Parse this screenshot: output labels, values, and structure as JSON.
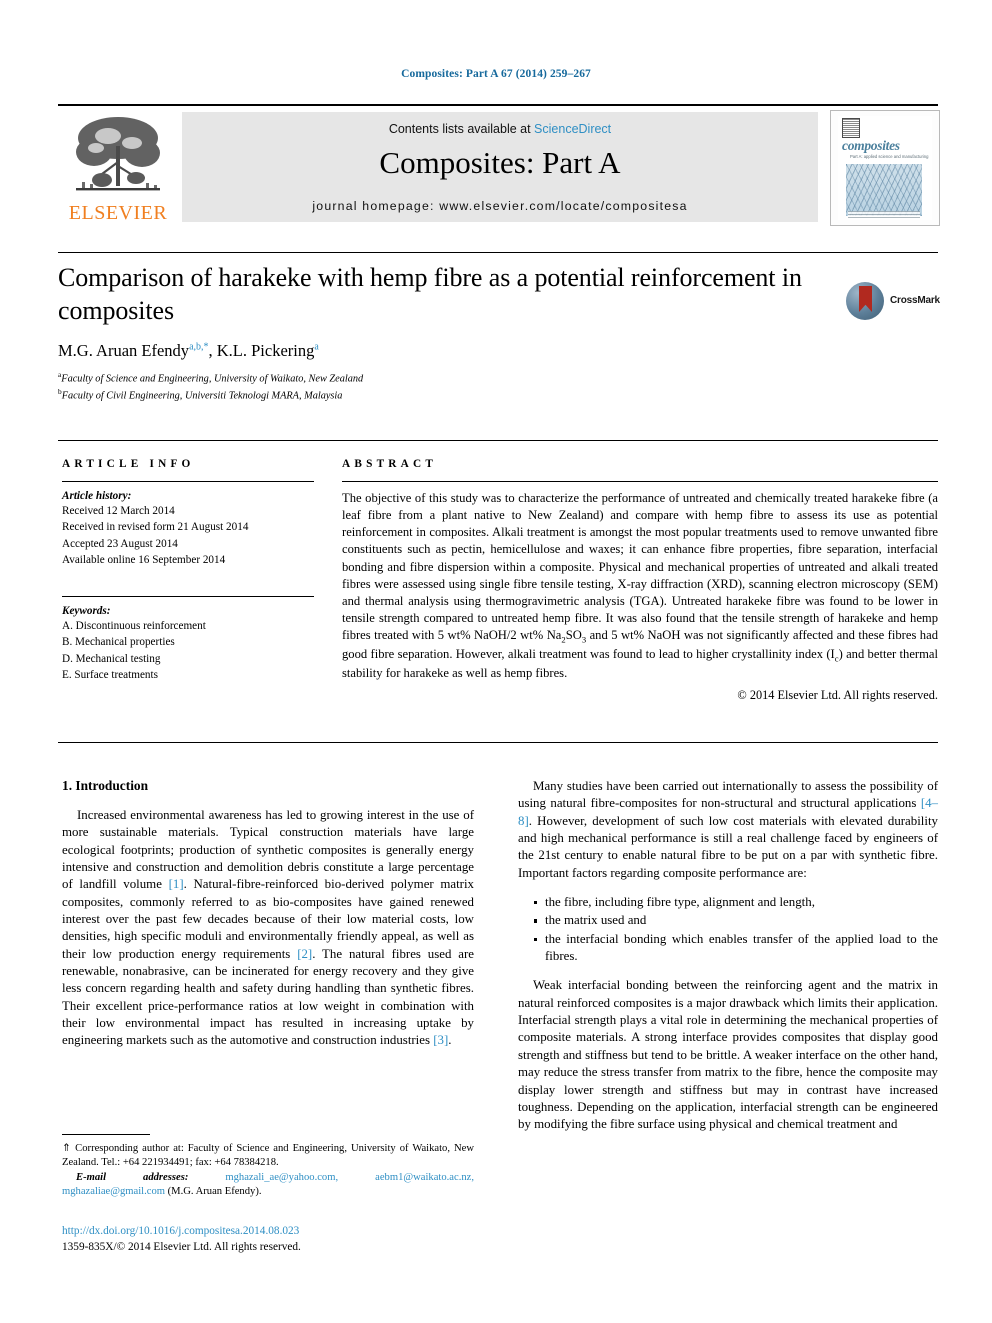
{
  "running_head": "Composites: Part A 67 (2014) 259–267",
  "masthead": {
    "publisher": "ELSEVIER",
    "contents_prefix": "Contents lists available at ",
    "sciencedirect": "ScienceDirect",
    "journal_name": "Composites: Part A",
    "homepage": "journal homepage: www.elsevier.com/locate/compositesa",
    "cover": {
      "title": "composites",
      "subtitle": "Part A: applied science and manufacturing"
    }
  },
  "article": {
    "title": "Comparison of harakeke with hemp fibre as a potential reinforcement in composites",
    "crossmark_label": "CrossMark",
    "authors_html": "M.G. Aruan Efendy<sup>a,b,</sup><sup>*</sup>, K.L. Pickering<sup>a</sup>",
    "affiliations": [
      {
        "marker": "a",
        "text": "Faculty of Science and Engineering, University of Waikato, New Zealand"
      },
      {
        "marker": "b",
        "text": "Faculty of Civil Engineering, Universiti Teknologi MARA, Malaysia"
      }
    ]
  },
  "article_info": {
    "heading": "ARTICLE INFO",
    "history_label": "Article history:",
    "history": [
      "Received 12 March 2014",
      "Received in revised form 21 August 2014",
      "Accepted 23 August 2014",
      "Available online 16 September 2014"
    ],
    "keywords_label": "Keywords:",
    "keywords": [
      "A. Discontinuous reinforcement",
      "B. Mechanical properties",
      "D. Mechanical testing",
      "E. Surface treatments"
    ]
  },
  "abstract": {
    "heading": "ABSTRACT",
    "part1": "The objective of this study was to characterize the performance of untreated and chemically treated harakeke fibre (a leaf fibre from a plant native to New Zealand) and compare with hemp fibre to assess its use as potential reinforcement in composites. Alkali treatment is amongst the most popular treatments used to remove unwanted fibre constituents such as pectin, hemicellulose and waxes; it can enhance fibre properties, fibre separation, interfacial bonding and fibre dispersion within a composite. Physical and mechanical properties of untreated and alkali treated fibres were assessed using single fibre tensile testing, X-ray diffraction (XRD), scanning electron microscopy (SEM) and thermal analysis using thermogravimetric analysis (TGA). Untreated harakeke fibre was found to be lower in tensile strength compared to untreated hemp fibre. It was also found that the tensile strength of harakeke and hemp fibres treated with 5 wt% NaOH/2 wt% Na",
    "sub1": "2",
    "part2": "SO",
    "sub2": "3",
    "part3": " and 5 wt% NaOH was not significantly affected and these fibres had good fibre separation. However, alkali treatment was found to lead to higher crystallinity index (I",
    "sub3": "c",
    "part4": ") and better thermal stability for harakeke as well as hemp fibres.",
    "copyright": "© 2014 Elsevier Ltd. All rights reserved."
  },
  "body": {
    "intro_heading": "1. Introduction",
    "left_p1_a": "Increased environmental awareness has led to growing interest in the use of more sustainable materials. Typical construction materials have large ecological footprints; production of synthetic composites is generally energy intensive and construction and demolition debris constitute a large percentage of landfill volume ",
    "left_ref1": "[1]",
    "left_p1_b": ". Natural-fibre-reinforced bio-derived polymer matrix composites, commonly referred to as bio-composites have gained renewed interest over the past few decades because of their low material costs, low densities, high specific moduli and environmentally friendly appeal, as well as their low production energy requirements ",
    "left_ref2": "[2]",
    "left_p1_c": ". The natural fibres used are renewable, nonabrasive, can be incinerated for energy recovery and they give less concern regarding health and safety during handling than synthetic fibres. Their excellent price-performance ratios at low weight in combination with their low environmental impact has resulted in increasing uptake by engineering markets such as the automotive and construction industries ",
    "left_ref3": "[3]",
    "left_p1_d": ".",
    "right_p1_a": "Many studies have been carried out internationally to assess the possibility of using natural fibre-composites for non-structural and structural applications ",
    "right_ref1": "[4–8]",
    "right_p1_b": ". However, development of such low cost materials with elevated durability and high mechanical performance is still a real challenge faced by engineers of the 21st century to enable natural fibre to be put on a par with synthetic fibre. Important factors regarding composite performance are:",
    "bullets": [
      "the fibre, including fibre type, alignment and length,",
      "the matrix used and",
      "the interfacial bonding which enables transfer of the applied load to the fibres."
    ],
    "right_p2": "Weak interfacial bonding between the reinforcing agent and the matrix in natural reinforced composites is a major drawback which limits their application. Interfacial strength plays a vital role in determining the mechanical properties of composite materials. A strong interface provides composites that display good strength and stiffness but tend to be brittle. A weaker interface on the other hand, may reduce the stress transfer from matrix to the fibre, hence the composite may display lower strength and stiffness but may in contrast have increased toughness. Depending on the application, interfacial strength can be engineered by modifying the fibre surface using physical and chemical treatment and"
  },
  "footnotes": {
    "corresponding_marker": "⇑",
    "corresponding": " Corresponding author at: Faculty of Science and Engineering, University of Waikato, New Zealand. Tel.: +64 221934491; fax: +64 78384218.",
    "email_label": "E-mail addresses:",
    "emails": "mghazali_ae@yahoo.com, aebm1@waikato.ac.nz, mghazaliae@gmail.com",
    "email_owner": " (M.G. Aruan Efendy).",
    "doi": "http://dx.doi.org/10.1016/j.compositesa.2014.08.023",
    "issn_line": "1359-835X/© 2014 Elsevier Ltd. All rights reserved."
  },
  "colors": {
    "link": "#2f8fc4",
    "runhead": "#16699c",
    "elsevier_orange": "#F07F20",
    "crossmark_red": "#b1291f"
  }
}
